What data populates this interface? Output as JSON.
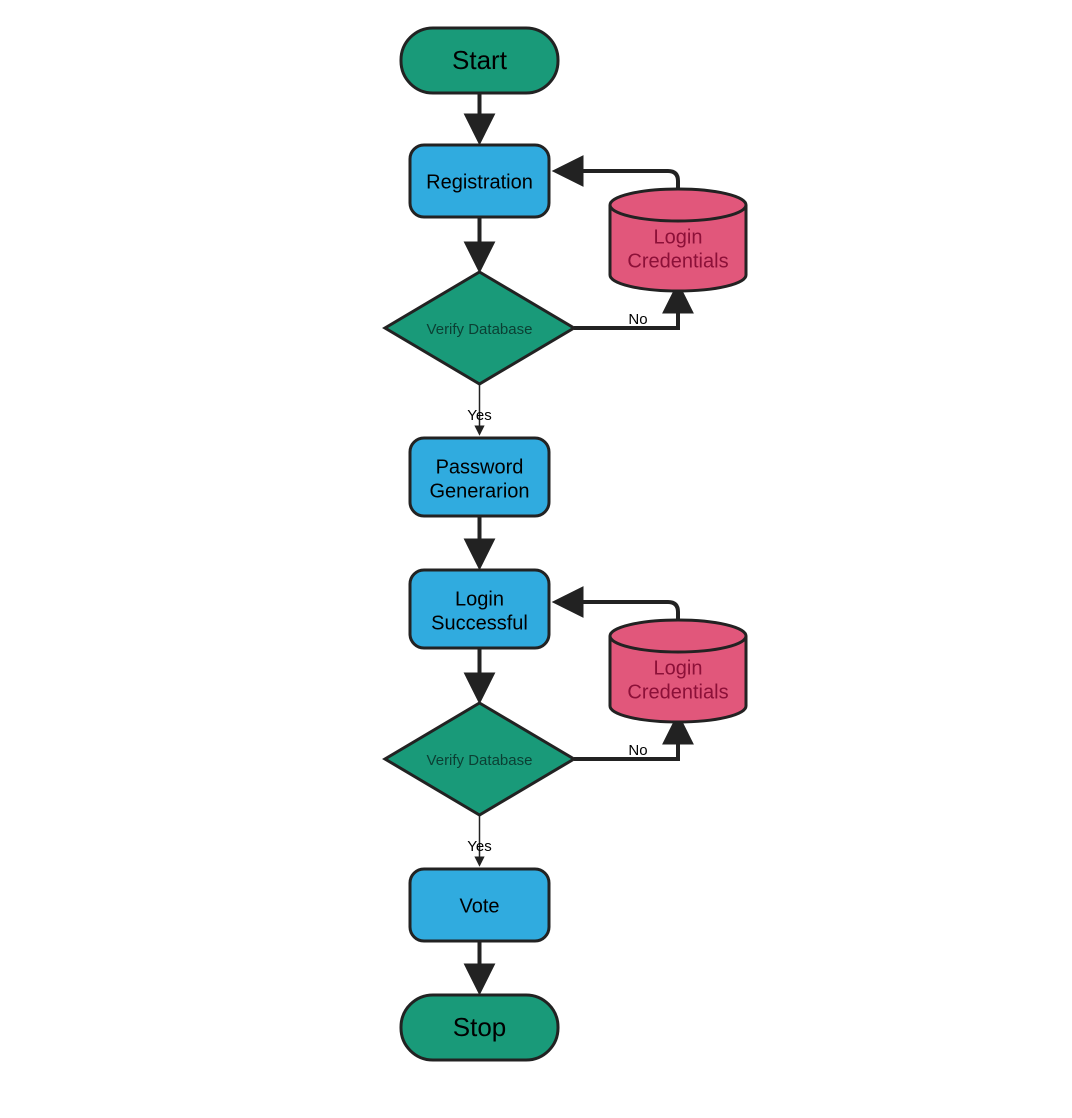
{
  "nodes": {
    "start": "Start",
    "registration": "Registration",
    "verify1": "Verify Database",
    "db1_line1": "Login",
    "db1_line2": "Credentials",
    "passwordgen_line1": "Password",
    "passwordgen_line2": "Generarion",
    "login_line1": "Login",
    "login_line2": "Successful",
    "verify2": "Verify Database",
    "db2_line1": "Login",
    "db2_line2": "Credentials",
    "vote": "Vote",
    "stop": "Stop"
  },
  "edges": {
    "yes1": "Yes",
    "no1": "No",
    "yes2": "Yes",
    "no2": "No"
  }
}
